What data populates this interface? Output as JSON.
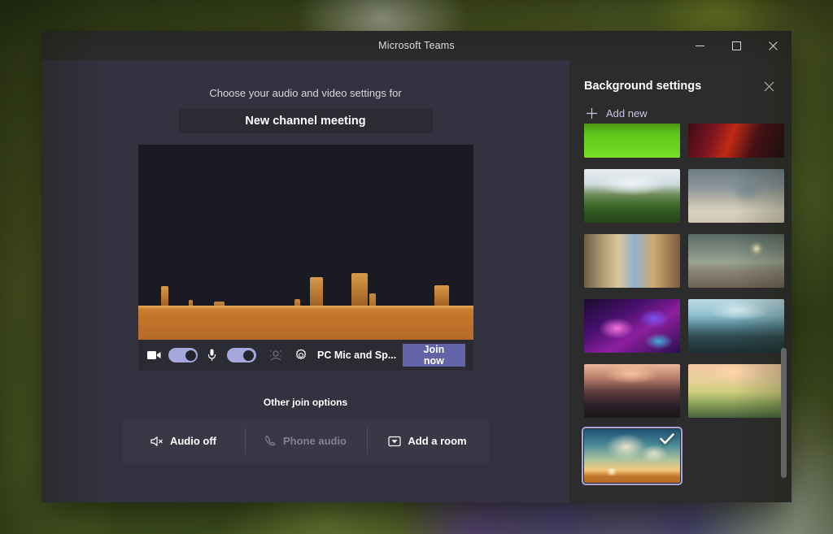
{
  "window": {
    "title": "Microsoft Teams",
    "controls": [
      {
        "name": "minimize",
        "glyph": "minimize-icon"
      },
      {
        "name": "maximize",
        "glyph": "maximize-icon"
      },
      {
        "name": "close",
        "glyph": "close-icon"
      }
    ]
  },
  "prejoin": {
    "prompt": "Choose your audio and video settings for",
    "meeting_title": "New channel meeting",
    "controls": {
      "camera_icon": "video-camera-icon",
      "camera_toggle_state": "on",
      "mic_icon": "microphone-icon",
      "mic_toggle_state": "on",
      "background_effects_icon": "background-effects-icon",
      "settings_icon": "gear-icon",
      "device_label": "PC Mic and Sp...",
      "join_label": "Join now"
    },
    "other_join_options_label": "Other join options",
    "join_options": [
      {
        "label": "Audio off",
        "icon": "speaker-muted-icon",
        "disabled": false
      },
      {
        "label": "Phone audio",
        "icon": "phone-icon",
        "disabled": true
      },
      {
        "label": "Add a room",
        "icon": "room-device-icon",
        "disabled": false
      }
    ]
  },
  "background_panel": {
    "title": "Background settings",
    "close_icon": "close-icon",
    "add_new_label": "Add new",
    "add_new_icon": "plus-icon",
    "selected_index": 10,
    "check_icon": "checkmark-icon",
    "thumbnails": [
      {
        "name": "green-bar-clipped",
        "alt": "Green image partially scrolled out of view"
      },
      {
        "name": "red-dark-clipped",
        "alt": "Red and dark image partially scrolled out of view"
      },
      {
        "name": "mountain-valley",
        "alt": "Green mountain valley with forest"
      },
      {
        "name": "sci-fi-arch-ruins",
        "alt": "Sci-fi ruins with large arch structure"
      },
      {
        "name": "village-stone-archway",
        "alt": "Stone archway over a medieval village street"
      },
      {
        "name": "alien-sunset-landscape",
        "alt": "Alien landscape with bright sun and tower"
      },
      {
        "name": "purple-nebula",
        "alt": "Pink and purple space nebula"
      },
      {
        "name": "cliffside-lake-tree",
        "alt": "Cliffside overlook with lake and lone tree"
      },
      {
        "name": "autumn-street-lanterns",
        "alt": "Autumn street with red lanterns at dusk"
      },
      {
        "name": "pastel-hill-figure",
        "alt": "Figure standing on a pastel sunset hillside"
      },
      {
        "name": "desert-swirl-clouds",
        "alt": "Desert mesas under swirling sunset clouds"
      }
    ],
    "scrollbar": {
      "position": "near-bottom"
    }
  },
  "colors": {
    "window_chrome": "#2b2b2b",
    "main_background": "#343140",
    "panel_background": "#2d2c2c",
    "accent_purple": "#6264a7",
    "toggle_on": "#a6a7dc",
    "link_purple": "#c8c6e8",
    "text_primary": "#ffffff",
    "text_muted": "#84818e"
  }
}
